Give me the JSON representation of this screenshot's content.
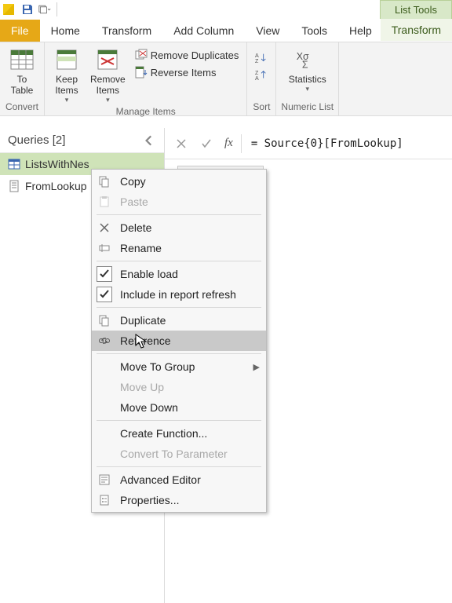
{
  "qat": {
    "dropdown_hint": "Customize"
  },
  "list_tools_label": "List Tools",
  "tabs": {
    "file": "File",
    "home": "Home",
    "transform": "Transform",
    "add_column": "Add Column",
    "view": "View",
    "tools": "Tools",
    "help": "Help",
    "ctx_transform": "Transform"
  },
  "ribbon": {
    "convert": {
      "to_table": "To\nTable",
      "group_label": "Convert"
    },
    "manage": {
      "keep": "Keep\nItems",
      "remove": "Remove\nItems",
      "remove_dup": "Remove Duplicates",
      "reverse": "Reverse Items",
      "group_label": "Manage Items"
    },
    "sort": {
      "group_label": "Sort"
    },
    "numeric": {
      "stats": "Statistics",
      "group_label": "Numeric List"
    }
  },
  "queries": {
    "header": "Queries [2]",
    "items": [
      {
        "name": "ListsWithNes"
      },
      {
        "name": "FromLookup"
      }
    ]
  },
  "formula": "= Source{0}[FromLookup]",
  "context_menu": {
    "copy": "Copy",
    "paste": "Paste",
    "delete": "Delete",
    "rename": "Rename",
    "enable_load": "Enable load",
    "include_refresh": "Include in report refresh",
    "duplicate": "Duplicate",
    "reference": "Reference",
    "move_to_group": "Move To Group",
    "move_up": "Move Up",
    "move_down": "Move Down",
    "create_function": "Create Function...",
    "convert_param": "Convert To Parameter",
    "advanced_editor": "Advanced Editor",
    "properties": "Properties..."
  }
}
